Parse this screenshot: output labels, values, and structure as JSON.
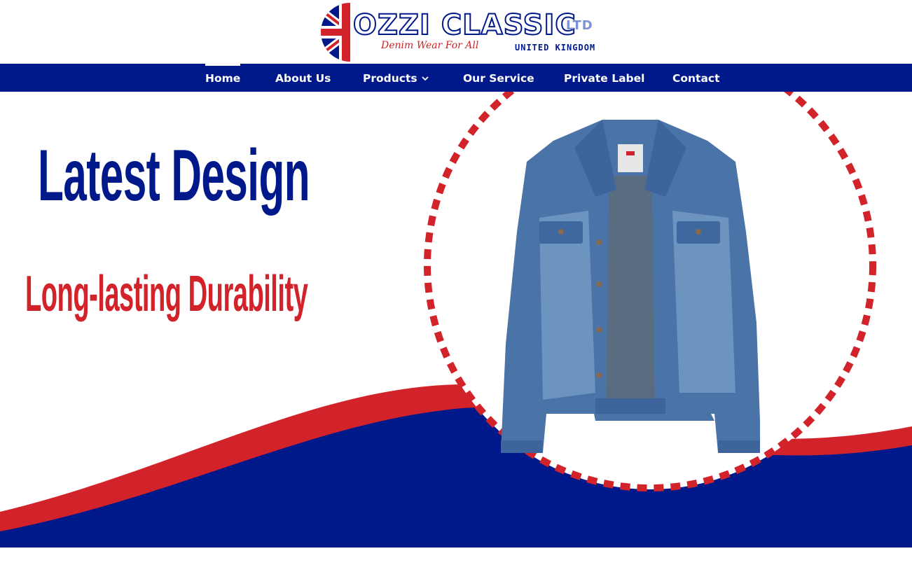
{
  "brand": {
    "name": "OZZI CLASSIC",
    "suffix": "LTD",
    "tagline": "Denim Wear For All",
    "country": "UNITED KINGDOM"
  },
  "nav": {
    "items": [
      {
        "label": "Home",
        "active": true
      },
      {
        "label": "About Us"
      },
      {
        "label": "Products",
        "has_dropdown": true,
        "icon": "chevron-down-icon"
      },
      {
        "label": "Our Service"
      },
      {
        "label": "Private Label"
      },
      {
        "label": "Contact"
      }
    ]
  },
  "hero": {
    "headline": "Latest Design",
    "subline": "Long-lasting Durability",
    "image_subject": "denim jacket"
  },
  "colors": {
    "navy": "#00198a",
    "red": "#d2232a",
    "white": "#ffffff"
  }
}
